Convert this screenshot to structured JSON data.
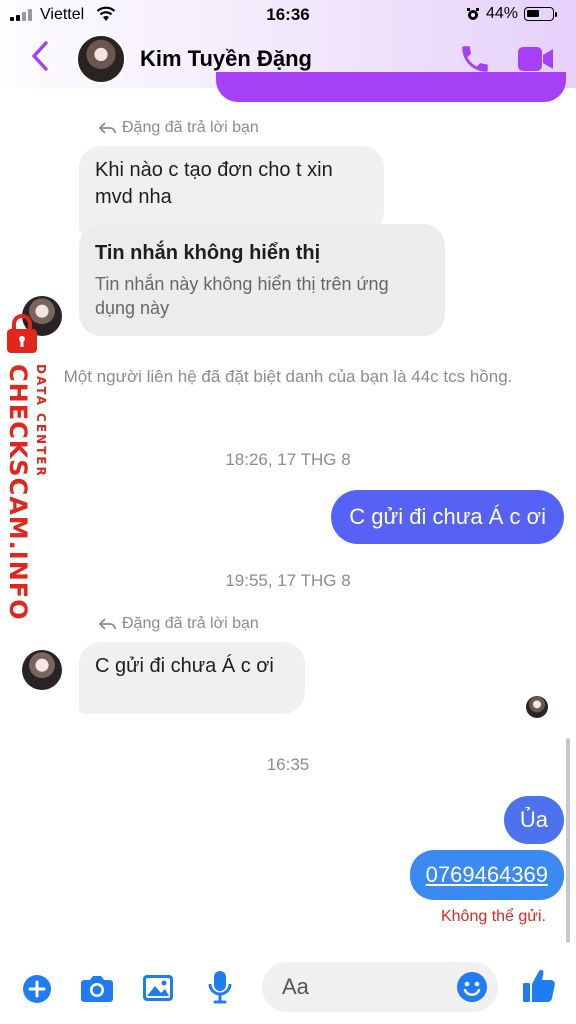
{
  "status_bar": {
    "carrier": "Viettel",
    "time": "16:36",
    "battery": "44%"
  },
  "header": {
    "contact_name": "Kim Tuyền Đặng",
    "back_icon": "chevron-left-icon",
    "call_icon": "phone-icon",
    "video_icon": "video-camera-icon"
  },
  "messages": {
    "reply_note_1": "Đặng đã trả lời bạn",
    "in_1": "Khi nào c tạo đơn cho t xin mvd nha",
    "unavailable_title": "Tin nhắn không hiển thị",
    "unavailable_body": "Tin nhắn này không hiển thị trên ứng dụng này",
    "nickname_notice": "Một người liên hệ đã đặt biệt danh của bạn là 44c tcs hồng.",
    "ts_1": "18:26, 17 THG 8",
    "out_1": "C gửi đi chưa Á c ơi",
    "ts_2": "19:55, 17 THG 8",
    "reply_note_2": "Đặng đã trả lời bạn",
    "in_2": "C gửi đi chưa Á c ơi",
    "ts_3": "16:35",
    "out_2": "Ủa",
    "out_3": "0769464369",
    "error": "Không thể gửi."
  },
  "watermark": {
    "brand": "CHECKSCAM.INFO",
    "sub": "DATA CENTER"
  },
  "composer": {
    "placeholder": "Aa"
  },
  "colors": {
    "accent": "#a540f4",
    "outgoing_bubble": "#5662f6",
    "incoming_bubble": "#f0f0f0",
    "error": "#e0271f",
    "watermark": "#e1261c"
  }
}
